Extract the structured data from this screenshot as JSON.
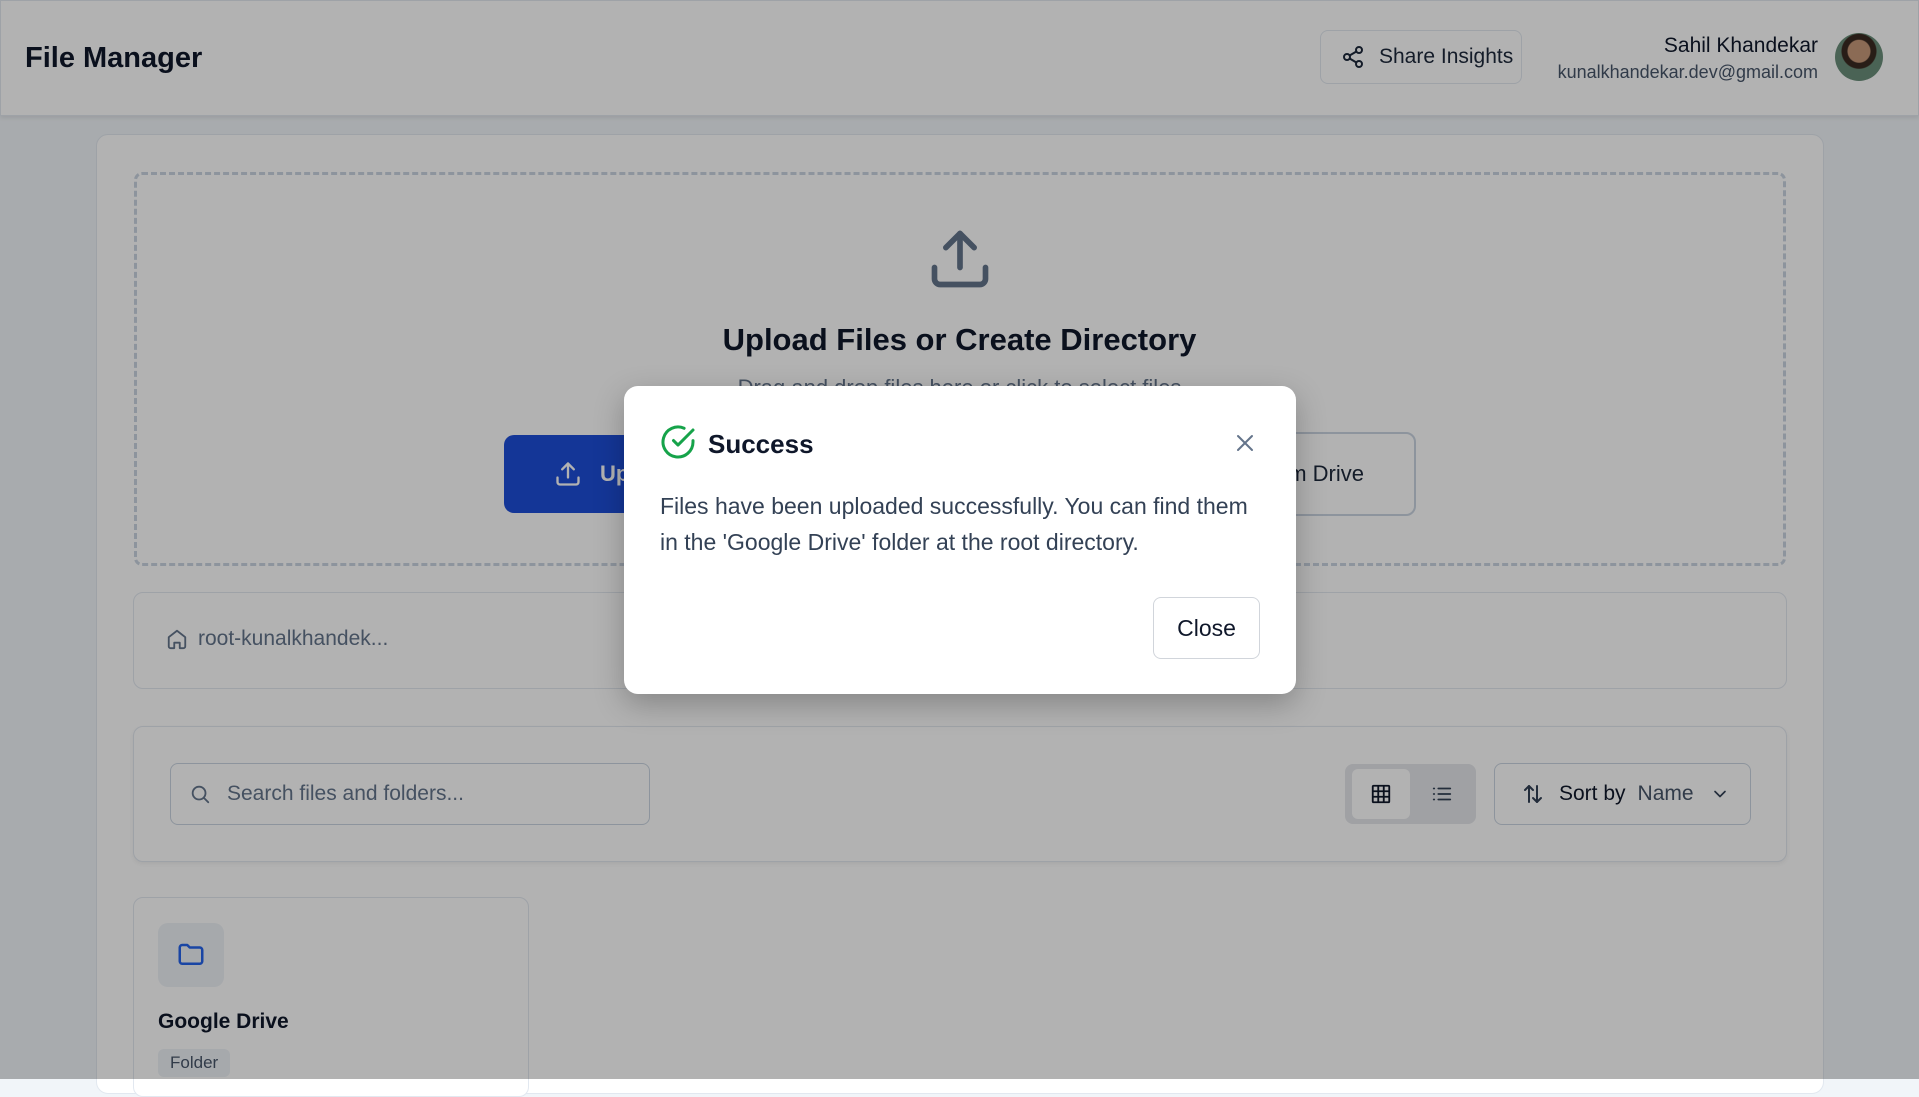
{
  "header": {
    "title": "File Manager",
    "share_label": "Share Insights",
    "user_name": "Sahil Khandekar",
    "user_email": "kunalkhandekar.dev@gmail.com"
  },
  "upload": {
    "title": "Upload Files or Create Directory",
    "subtitle": "Drag and drop files here or click to select files",
    "upload_button": "Up",
    "drive_button": "m Drive"
  },
  "breadcrumb": {
    "root_label": "root-kunalkhandek..."
  },
  "toolbar": {
    "search_placeholder": "Search files and folders...",
    "sort_label": "Sort by",
    "sort_value": "Name"
  },
  "items": [
    {
      "name": "Google Drive",
      "type": "Folder"
    }
  ],
  "modal": {
    "title": "Success",
    "message": "Files have been uploaded successfully. You can find them in the 'Google Drive' folder at the root directory.",
    "close_label": "Close"
  },
  "colors": {
    "accent": "#1d4ed8",
    "success": "#16a34a",
    "overlay": "rgba(0,0,0,0.30)"
  }
}
